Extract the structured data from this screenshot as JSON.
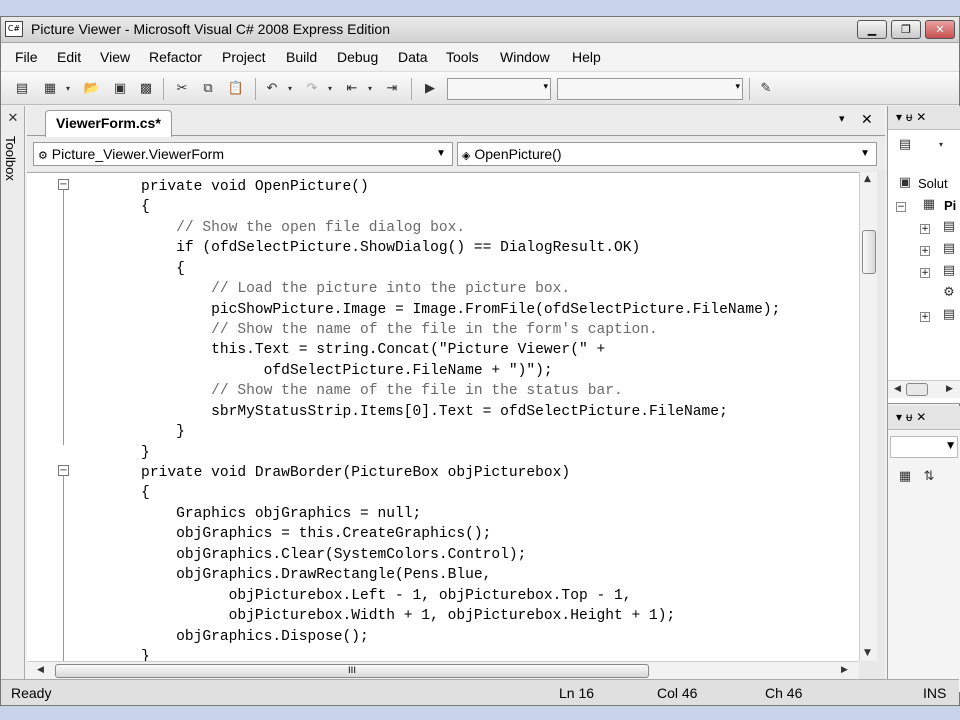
{
  "window": {
    "title": "Picture Viewer - Microsoft Visual C# 2008 Express Edition",
    "app_icon_text": "C#",
    "minimize": "▁",
    "restore": "❐",
    "close": "✕"
  },
  "menu": [
    "File",
    "Edit",
    "View",
    "Refactor",
    "Project",
    "Build",
    "Debug",
    "Data",
    "Tools",
    "Window",
    "Help"
  ],
  "toolbox": {
    "label": "Toolbox"
  },
  "editor": {
    "tab_label": "ViewerForm.cs*",
    "tab_dropdown": "▾",
    "tab_close": "✕",
    "class_combo": "Picture_Viewer.ViewerForm",
    "member_combo": "OpenPicture()",
    "code_lines": [
      "        private void OpenPicture()",
      "        {",
      "            // Show the open file dialog box.",
      "            if (ofdSelectPicture.ShowDialog() == DialogResult.OK)",
      "            {",
      "                // Load the picture into the picture box.",
      "                picShowPicture.Image = Image.FromFile(ofdSelectPicture.FileName);",
      "                // Show the name of the file in the form's caption.",
      "                this.Text = string.Concat(\"Picture Viewer(\" +",
      "                      ofdSelectPicture.FileName + \")\");",
      "                // Show the name of the file in the status bar.",
      "                sbrMyStatusStrip.Items[0].Text = ofdSelectPicture.FileName;",
      "            }",
      "        }",
      "        private void DrawBorder(PictureBox objPicturebox)",
      "        {",
      "            Graphics objGraphics = null;",
      "            objGraphics = this.CreateGraphics();",
      "            objGraphics.Clear(SystemColors.Control);",
      "            objGraphics.DrawRectangle(Pens.Blue,",
      "                  objPicturebox.Left - 1, objPicturebox.Top - 1,",
      "                  objPicturebox.Width + 1, objPicturebox.Height + 1);",
      "            objGraphics.Dispose();",
      "        }"
    ],
    "hscroll_grip": "III"
  },
  "solution_explorer": {
    "header_pin": "▾ ᵾ ✕",
    "item_solution": "Solut",
    "item_project": "Pi"
  },
  "status": {
    "ready": "Ready",
    "ln": "Ln 16",
    "col": "Col 46",
    "ch": "Ch 46",
    "mode": "INS"
  }
}
